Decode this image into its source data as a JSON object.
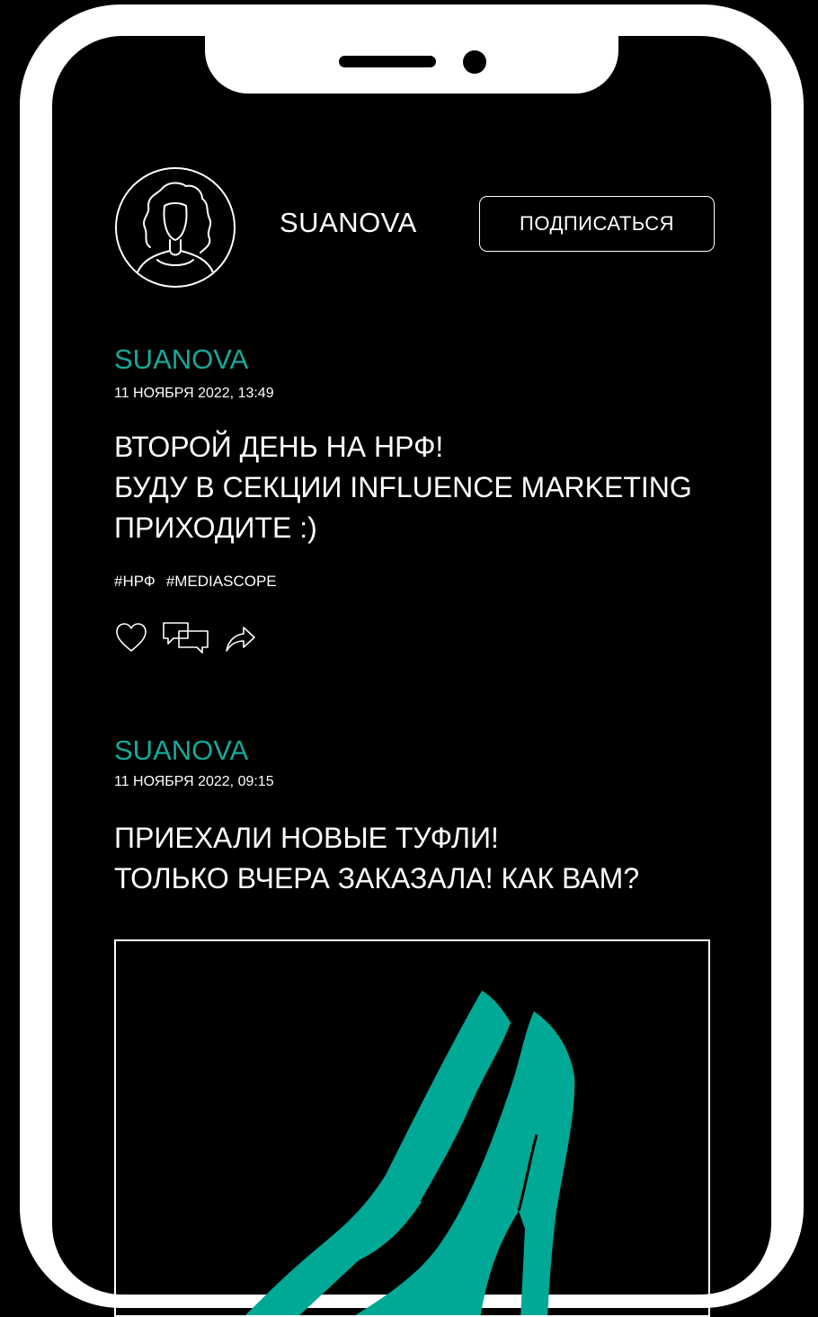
{
  "profile": {
    "name": "SUANOVA",
    "subscribe_label": "ПОДПИСАТЬСЯ"
  },
  "posts": [
    {
      "author": "SUANOVA",
      "date": "11 НОЯБРЯ 2022, 13:49",
      "lines": [
        "ВТОРОЙ ДЕНЬ НА НРФ!",
        "БУДУ В СЕКЦИИ INFLUENCE MARKETING",
        "ПРИХОДИТЕ :)"
      ],
      "tags": [
        "#НРФ",
        "#MEDIASCOPE"
      ],
      "actions": [
        "heart-icon",
        "comments-icon",
        "share-icon"
      ]
    },
    {
      "author": "SUANOVA",
      "date": "11 НОЯБРЯ 2022, 09:15",
      "lines": [
        "ПРИЕХАЛИ НОВЫЕ ТУФЛИ!",
        "ТОЛЬКО ВЧЕРА ЗАКАЗАЛА! КАК ВАМ?"
      ],
      "image": "high-heel-shoe-illustration"
    }
  ],
  "colors": {
    "background": "#000000",
    "frame": "#ffffff",
    "accent": "#14a99a",
    "shoe": "#00a896"
  }
}
